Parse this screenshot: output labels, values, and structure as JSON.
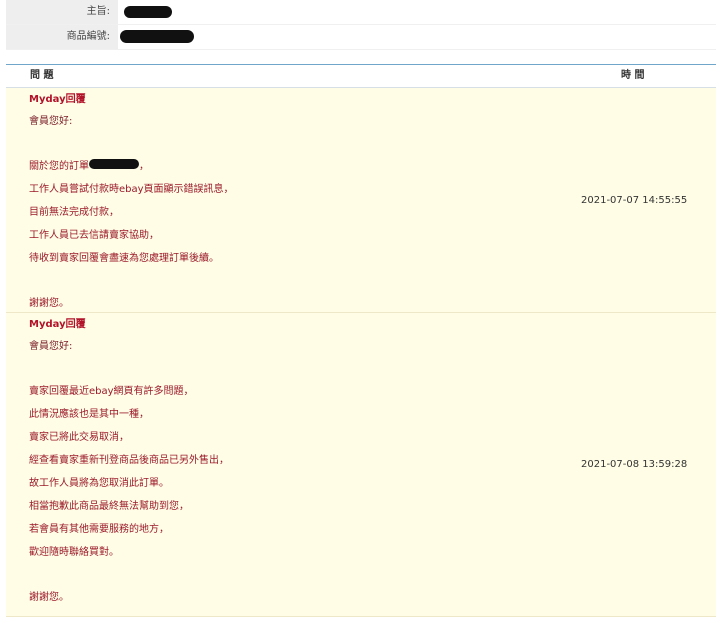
{
  "info": {
    "subject_label": "主旨:",
    "product_no_label": "商品編號:"
  },
  "table": {
    "col_question": "問 題",
    "col_time": "時 間"
  },
  "replies": [
    {
      "title": "Myday回覆",
      "greeting": "會員您好:",
      "order_prefix": "關於您的訂單",
      "order_suffix": "，",
      "lines": [
        "工作人員嘗試付款時ebay頁面顯示錯誤訊息，",
        "目前無法完成付款，",
        "工作人員已去信請賣家協助，",
        "待收到賣家回覆會盡速為您處理訂單後續。"
      ],
      "closing": "謝謝您。",
      "time": "2021-07-07 14:55:55"
    },
    {
      "title": "Myday回覆",
      "greeting": "會員您好:",
      "lines": [
        "賣家回覆最近ebay網頁有許多問題，",
        "此情況應該也是其中一種，",
        "賣家已將此交易取消，",
        "經查看賣家重新刊登商品後商品已另外售出，",
        "故工作人員將為您取消此訂單。",
        "相當抱歉此商品最終無法幫助到您，",
        "若會員有其他需要服務的地方，",
        "歡迎隨時聯絡買對。"
      ],
      "closing": "謝謝您。",
      "time": "2021-07-08 13:59:28"
    }
  ]
}
